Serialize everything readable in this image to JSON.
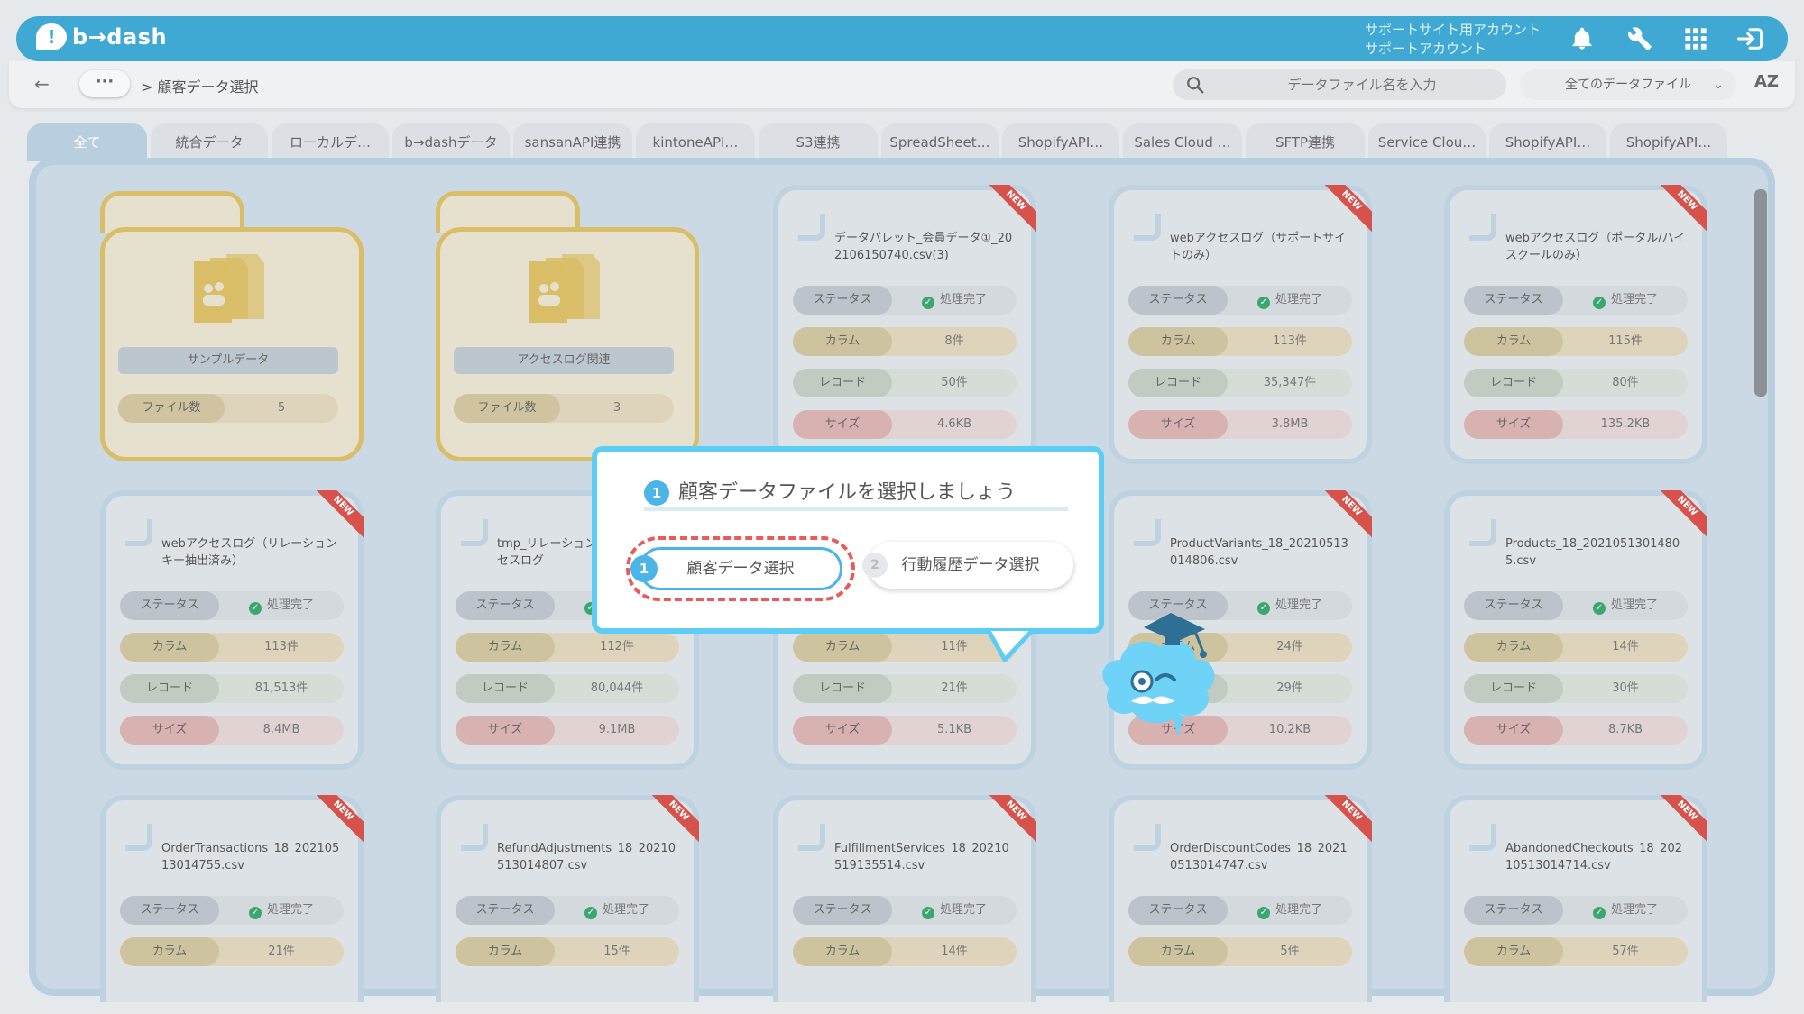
{
  "app": {
    "logo_text": "b→dash",
    "account_line1": "サポートサイト用アカウント",
    "account_line2": "サポートアカウント",
    "icons": [
      "bell-icon",
      "wrench-icon",
      "grid-icon",
      "logout-icon"
    ]
  },
  "toolbar": {
    "breadcrumb_more": "···",
    "breadcrumb_current": "> 顧客データ選択",
    "search_placeholder": "データファイル名を入力",
    "file_filter": "全てのデータファイル",
    "sort_label": "AZ"
  },
  "tabs": [
    "全て",
    "統合データ",
    "ローカルデ…",
    "b→dashデータ",
    "sansanAPI連携",
    "kintoneAPI…",
    "S3連携",
    "SpreadSheet…",
    "ShopifyAPI…",
    "Sales Cloud …",
    "SFTP連携",
    "Service Clou…",
    "ShopifyAPI…",
    "ShopifyAPI…"
  ],
  "labels": {
    "status": "ステータス",
    "column": "カラム",
    "record": "レコード",
    "size": "サイズ",
    "file_count": "ファイル数",
    "done": "処理完了",
    "new": "NEW"
  },
  "folders": [
    {
      "name": "サンプルデータ",
      "count": "5"
    },
    {
      "name": "アクセスログ関連",
      "count": "3"
    }
  ],
  "files": [
    {
      "title": "データパレット_会員データ①_20210615074​0.csv(3)",
      "columns": "8件",
      "records": "50件",
      "size": "4.6KB"
    },
    {
      "title": "webアクセスログ（サポートサイトのみ）",
      "columns": "113件",
      "records": "35,347件",
      "size": "3.8MB"
    },
    {
      "title": "webアクセスログ（ポータル/ハイスクールのみ）",
      "columns": "115件",
      "records": "80件",
      "size": "135.2KB"
    },
    {
      "title": "webアクセスログ（リレーションキー抽出済み）",
      "columns": "113件",
      "records": "81,513件",
      "size": "8.4MB"
    },
    {
      "title": "tmp_リレーションキー付きアクセスログ",
      "columns": "112件",
      "records": "80,044件",
      "size": "9.1MB"
    },
    {
      "title": "",
      "columns": "11件",
      "records": "21件",
      "size": "5.1KB"
    },
    {
      "title": "ProductVariants_18_20210513014806.csv",
      "columns": "24件",
      "records": "29件",
      "size": "10.2KB"
    },
    {
      "title": "Products_18_20210513014805.csv",
      "columns": "14件",
      "records": "30件",
      "size": "8.7KB"
    },
    {
      "title": "OrderTransactions_18_20210513014755.csv",
      "columns": "21件"
    },
    {
      "title": "RefundAdjustments_18_20210513014807.csv",
      "columns": "15件"
    },
    {
      "title": "FulfillmentServices_18_20210519135514.csv",
      "columns": "14件"
    },
    {
      "title": "OrderDiscountCodes_18_20210513014747.csv",
      "columns": "5件"
    },
    {
      "title": "AbandonedCheckouts_18_20210513014714.csv",
      "columns": "57件"
    }
  ],
  "popup": {
    "step_num": "1",
    "title": "顧客データファイルを選択しましょう",
    "btn1_num": "1",
    "btn1_label": "顧客データ選択",
    "btn2_num": "2",
    "btn2_label": "行動履歴データ選択"
  },
  "colors": {
    "header": "#3fa9d4",
    "popup_border": "#5dcdf5",
    "highlight_dash": "#e95a5a",
    "new_ribbon": "#d7524a",
    "folder_border": "#d9be67"
  }
}
